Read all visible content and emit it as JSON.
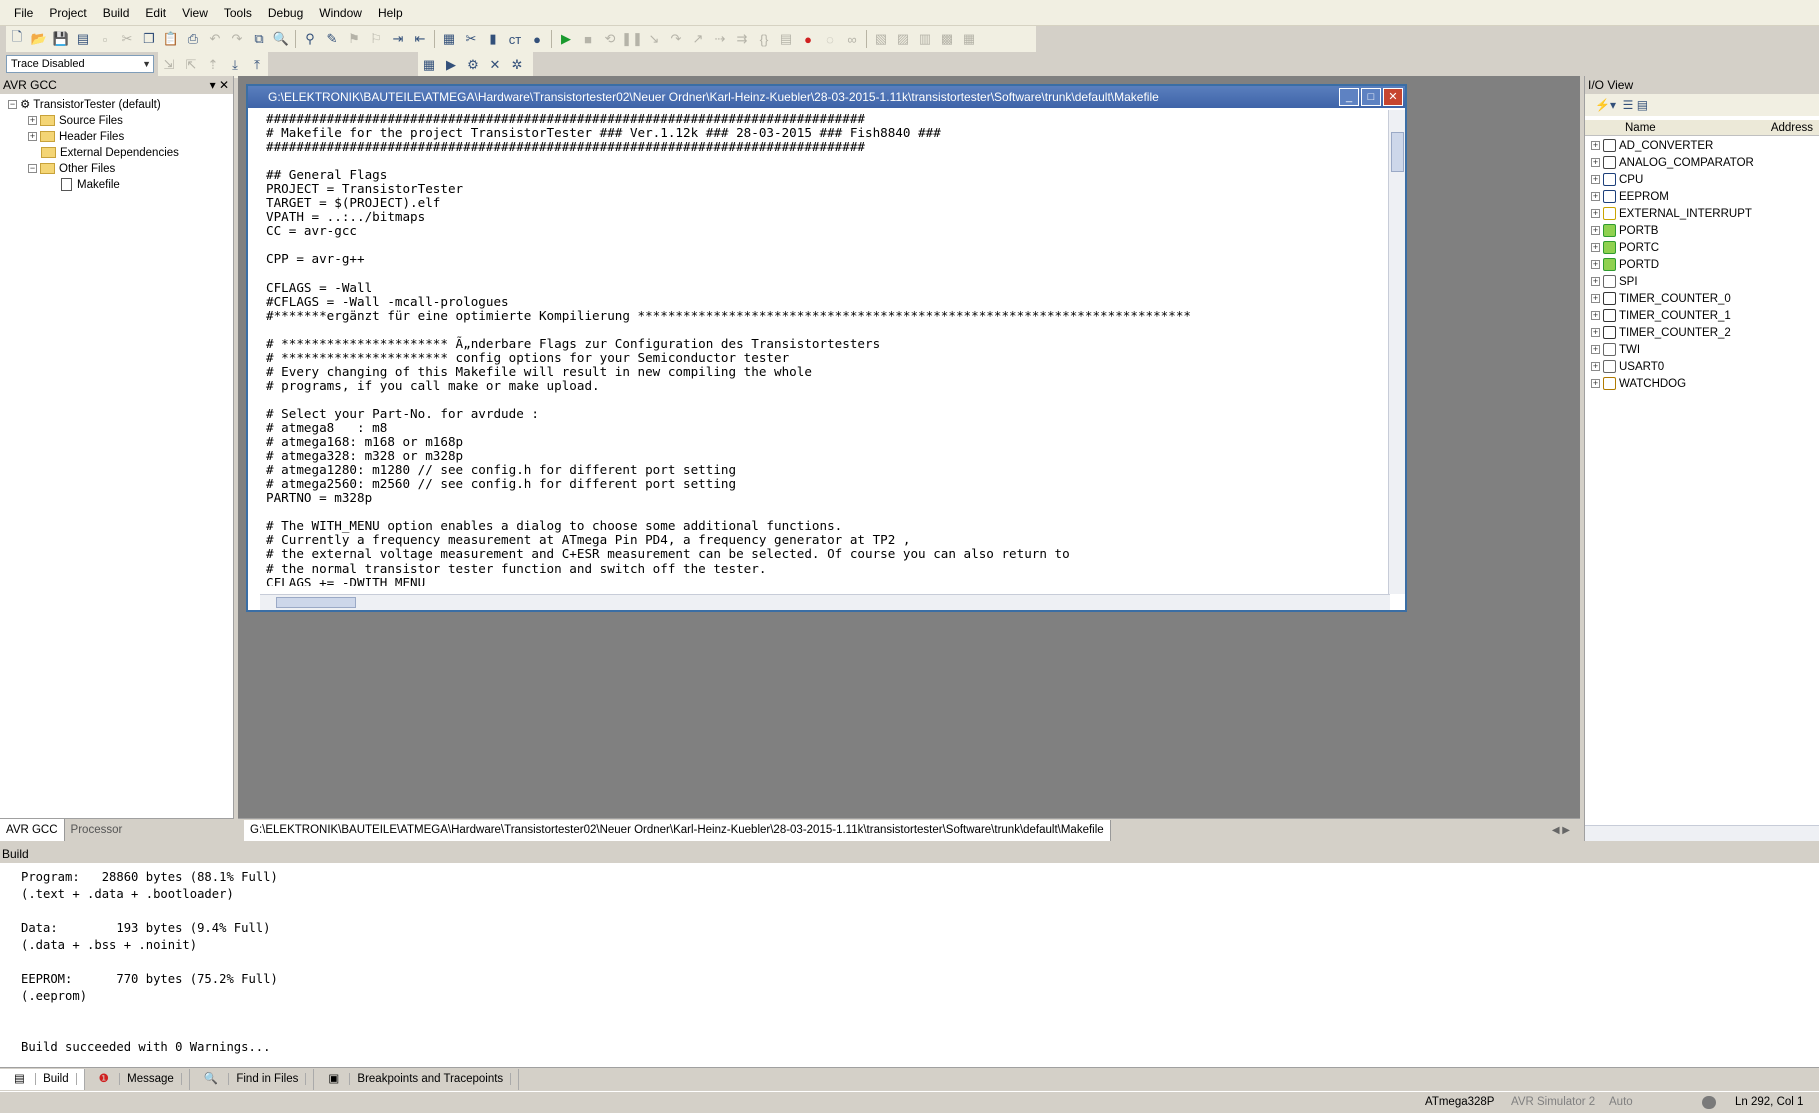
{
  "menu": [
    "File",
    "Project",
    "Build",
    "Edit",
    "View",
    "Tools",
    "Debug",
    "Window",
    "Help"
  ],
  "toolbar": {
    "trace_mode": "Trace Disabled"
  },
  "left_pane": {
    "title": "AVR GCC",
    "close": "✕",
    "tree": [
      {
        "label": "TransistorTester (default)",
        "level": 0,
        "expander": "−"
      },
      {
        "label": "Source Files",
        "level": 1,
        "expander": "+"
      },
      {
        "label": "Header Files",
        "level": 1,
        "expander": "+"
      },
      {
        "label": "External Dependencies",
        "level": 1,
        "expander": ""
      },
      {
        "label": "Other Files",
        "level": 1,
        "expander": "−"
      },
      {
        "label": "Makefile",
        "level": 2,
        "expander": ""
      }
    ],
    "tabs": [
      "AVR GCC",
      "Processor"
    ]
  },
  "editor": {
    "title": "G:\\ELEKTRONIK\\BAUTEILE\\ATMEGA\\Hardware\\Transistortester02\\Neuer Ordner\\Karl-Heinz-Kuebler\\28-03-2015-1.11k\\transistortester\\Software\\trunk\\default\\Makefile",
    "lines": [
      "###############################################################################",
      "# Makefile for the project TransistorTester ### Ver.1.12k ### 28-03-2015 ### Fish8840 ###",
      "###############################################################################",
      "",
      "## General Flags",
      "PROJECT = TransistorTester",
      "TARGET = $(PROJECT).elf",
      "VPATH = ..:../bitmaps",
      "CC = avr-gcc",
      "",
      "CPP = avr-g++",
      "",
      "CFLAGS = -Wall",
      "#CFLAGS = -Wall -mcall-prologues",
      "#*******ergänzt für eine optimierte Kompilierung *************************************************************************",
      "",
      "# ********************** Ã„nderbare Flags zur Configuration des Transistortesters",
      "# ********************** config options for your Semiconductor tester",
      "# Every changing of this Makefile will result in new compiling the whole",
      "# programs, if you call make or make upload.",
      "",
      "# Select your Part-No. for avrdude :",
      "# atmega8   : m8",
      "# atmega168: m168 or m168p",
      "# atmega328: m328 or m328p",
      "# atmega1280: m1280 // see config.h for different port setting",
      "# atmega2560: m2560 // see config.h for different port setting",
      "PARTNO = m328p",
      "",
      "# The WITH_MENU option enables a dialog to choose some additional functions.",
      "# Currently a frequency measurement at ATmega Pin PD4, a frequency generator at TP2 ,",
      "# the external voltage measurement and C+ESR measurement can be selected. Of course you can also return to",
      "# the normal transistor tester function and switch off the tester.",
      "CFLAGS += -DWITH_MENU"
    ]
  },
  "doc_tab": "G:\\ELEKTRONIK\\BAUTEILE\\ATMEGA\\Hardware\\Transistortester02\\Neuer Ordner\\Karl-Heinz-Kuebler\\28-03-2015-1.11k\\transistortester\\Software\\trunk\\default\\Makefile",
  "io_view": {
    "title": "I/O View",
    "col_name": "Name",
    "col_address": "Address",
    "items": [
      {
        "name": "AD_CONVERTER",
        "icon": "converter-icon"
      },
      {
        "name": "ANALOG_COMPARATOR",
        "icon": "comparator-icon"
      },
      {
        "name": "CPU",
        "icon": "cpu-icon"
      },
      {
        "name": "EEPROM",
        "icon": "eeprom-icon"
      },
      {
        "name": "EXTERNAL_INTERRUPT",
        "icon": "interrupt-icon"
      },
      {
        "name": "PORTB",
        "icon": "port-icon"
      },
      {
        "name": "PORTC",
        "icon": "port-icon"
      },
      {
        "name": "PORTD",
        "icon": "port-icon"
      },
      {
        "name": "SPI",
        "icon": "spi-icon"
      },
      {
        "name": "TIMER_COUNTER_0",
        "icon": "timer-icon"
      },
      {
        "name": "TIMER_COUNTER_1",
        "icon": "timer-icon"
      },
      {
        "name": "TIMER_COUNTER_2",
        "icon": "timer-icon"
      },
      {
        "name": "TWI",
        "icon": "twi-icon"
      },
      {
        "name": "USART0",
        "icon": "usart-icon"
      },
      {
        "name": "WATCHDOG",
        "icon": "watchdog-icon"
      }
    ]
  },
  "build": {
    "title": "Build",
    "text": "Program:   28860 bytes (88.1% Full)\n(.text + .data + .bootloader)\n\nData:        193 bytes (9.4% Full)\n(.data + .bss + .noinit)\n\nEEPROM:      770 bytes (75.2% Full)\n(.eeprom)\n\n\nBuild succeeded with 0 Warnings..."
  },
  "bottom_tabs": [
    "Build",
    "Message",
    "Find in Files",
    "Breakpoints and Tracepoints"
  ],
  "status": {
    "device": "ATmega328P",
    "platform": "AVR Simulator 2",
    "mode": "Auto",
    "position": "Ln 292, Col 1"
  }
}
